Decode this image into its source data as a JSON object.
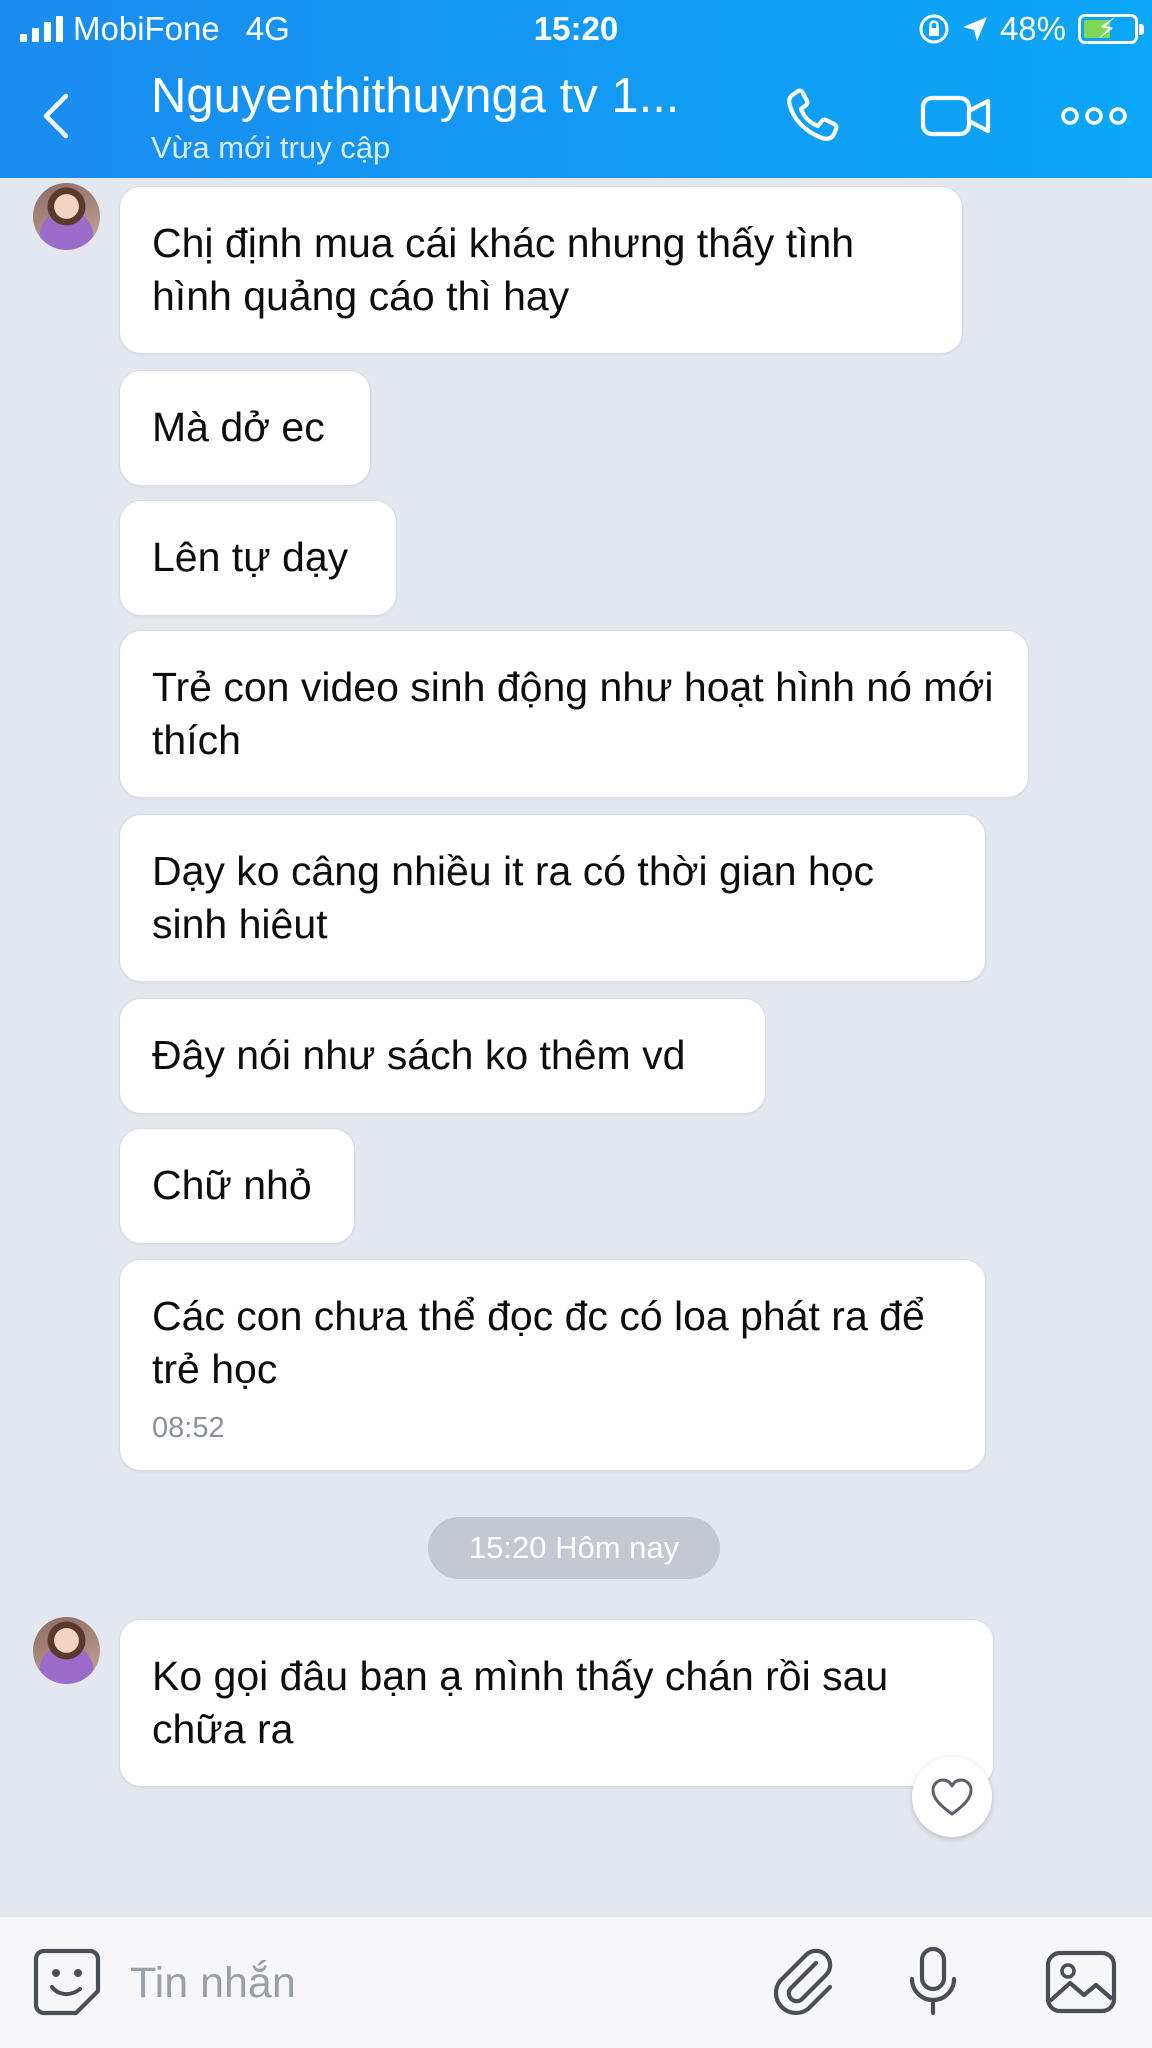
{
  "status_bar": {
    "carrier": "MobiFone",
    "network": "4G",
    "time": "15:20",
    "battery": "48%"
  },
  "header": {
    "contact_name": "Nguyenthithuynga tv 1...",
    "status": "Vừa mới truy cập",
    "icons": [
      "back-icon",
      "phone-icon",
      "video-call-icon",
      "more-icon"
    ]
  },
  "messages": [
    {
      "text": "Chị định mua cái khác nhưng thấy tình hình quảng cáo thì hay"
    },
    {
      "text": "Mà dở ec"
    },
    {
      "text": "Lên tự dạy"
    },
    {
      "text": "Trẻ con video sinh động như hoạt hình nó mới thích"
    },
    {
      "text": "Dạy ko câng nhiều it ra có thời gian học sinh hiêut"
    },
    {
      "text": "Đây nói như sách ko thêm vd"
    },
    {
      "text": "Chữ nhỏ"
    },
    {
      "text": "Các con chưa thể đọc đc có loa phát ra để trẻ học",
      "time": "08:52"
    },
    {
      "text": "Ko gọi đâu bạn ạ mình thấy chán rồi sau chữa ra"
    }
  ],
  "date_divider": "15:20 Hôm nay",
  "composer": {
    "placeholder": "Tin nhắn",
    "icons": [
      "sticker-icon",
      "attachment-icon",
      "microphone-icon",
      "image-icon"
    ]
  },
  "colors": {
    "header_start": "#1a8cf0",
    "header_end": "#0aa6f7",
    "chat_background": "#e3e7f0",
    "bubble": "#ffffff",
    "battery_fill": "#7ed957"
  }
}
